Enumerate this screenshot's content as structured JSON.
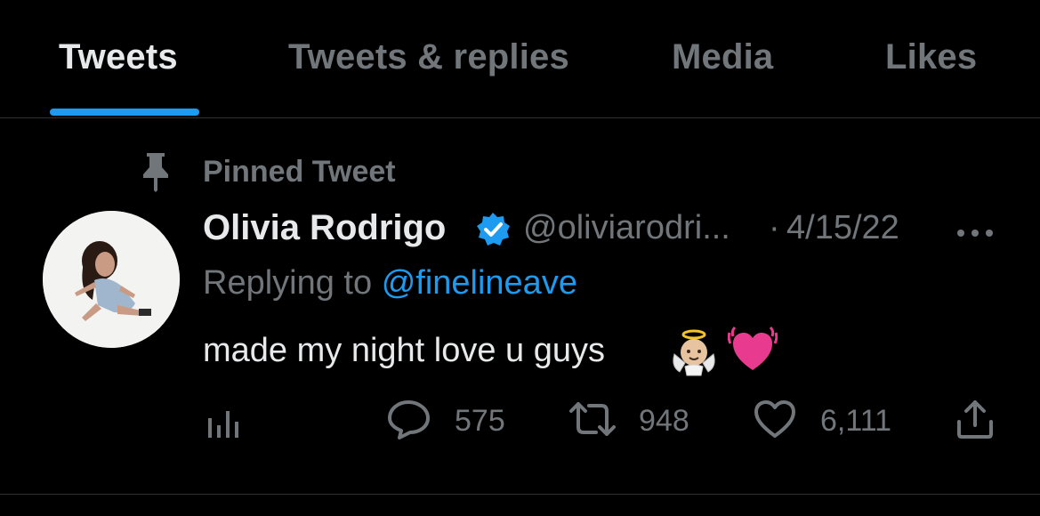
{
  "tabs": [
    {
      "label": "Tweets",
      "active": true
    },
    {
      "label": "Tweets & replies",
      "active": false
    },
    {
      "label": "Media",
      "active": false
    },
    {
      "label": "Likes",
      "active": false
    }
  ],
  "colors": {
    "accent": "#1d9bf0",
    "secondary_text": "#71767b",
    "primary_text": "#e7e9ea",
    "background": "#000000",
    "heart_emoji": "#e83b8f"
  },
  "tweet": {
    "pinned_label": "Pinned Tweet",
    "display_name": "Olivia Rodrigo",
    "verified": true,
    "handle": "@oliviarodri...",
    "separator": "·",
    "date": "4/15/22",
    "replying_to_prefix": "Replying to",
    "replying_to_handle": "@finelineave",
    "text": "made my night love u guys",
    "emojis": [
      "baby-angel-emoji",
      "beating-heart-emoji"
    ],
    "stats": {
      "replies": "575",
      "retweets": "948",
      "likes": "6,111"
    },
    "icons": [
      "pin-icon",
      "verified-badge-icon",
      "more-icon",
      "analytics-icon",
      "reply-icon",
      "retweet-icon",
      "like-icon",
      "share-icon"
    ]
  }
}
